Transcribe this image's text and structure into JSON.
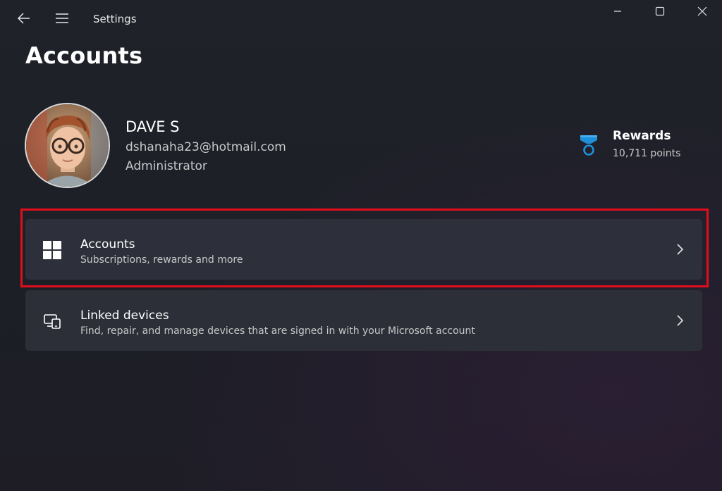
{
  "window": {
    "title": "Settings",
    "controls": {
      "minimize": "minimize-icon",
      "maximize": "maximize-icon",
      "close": "close-icon"
    }
  },
  "nav": {
    "back_icon": "back-arrow-icon",
    "menu_icon": "hamburger-menu-icon"
  },
  "page": {
    "title": "Accounts"
  },
  "profile": {
    "name": "DAVE S",
    "email": "dshanaha23@hotmail.com",
    "role": "Administrator"
  },
  "rewards": {
    "title": "Rewards",
    "points": "10,711 points",
    "icon": "rewards-medal-icon",
    "icon_color": "#1e8fd8"
  },
  "cards": [
    {
      "title": "Accounts",
      "subtitle": "Subscriptions, rewards and more",
      "icon": "windows-logo-icon",
      "highlighted": true
    },
    {
      "title": "Linked devices",
      "subtitle": "Find, repair, and manage devices that are signed in with your Microsoft account",
      "icon": "linked-devices-icon",
      "highlighted": false
    }
  ],
  "colors": {
    "highlight": "#e30d1b",
    "card_bg": "#2c2f38",
    "text_secondary": "#c8c8c8"
  }
}
